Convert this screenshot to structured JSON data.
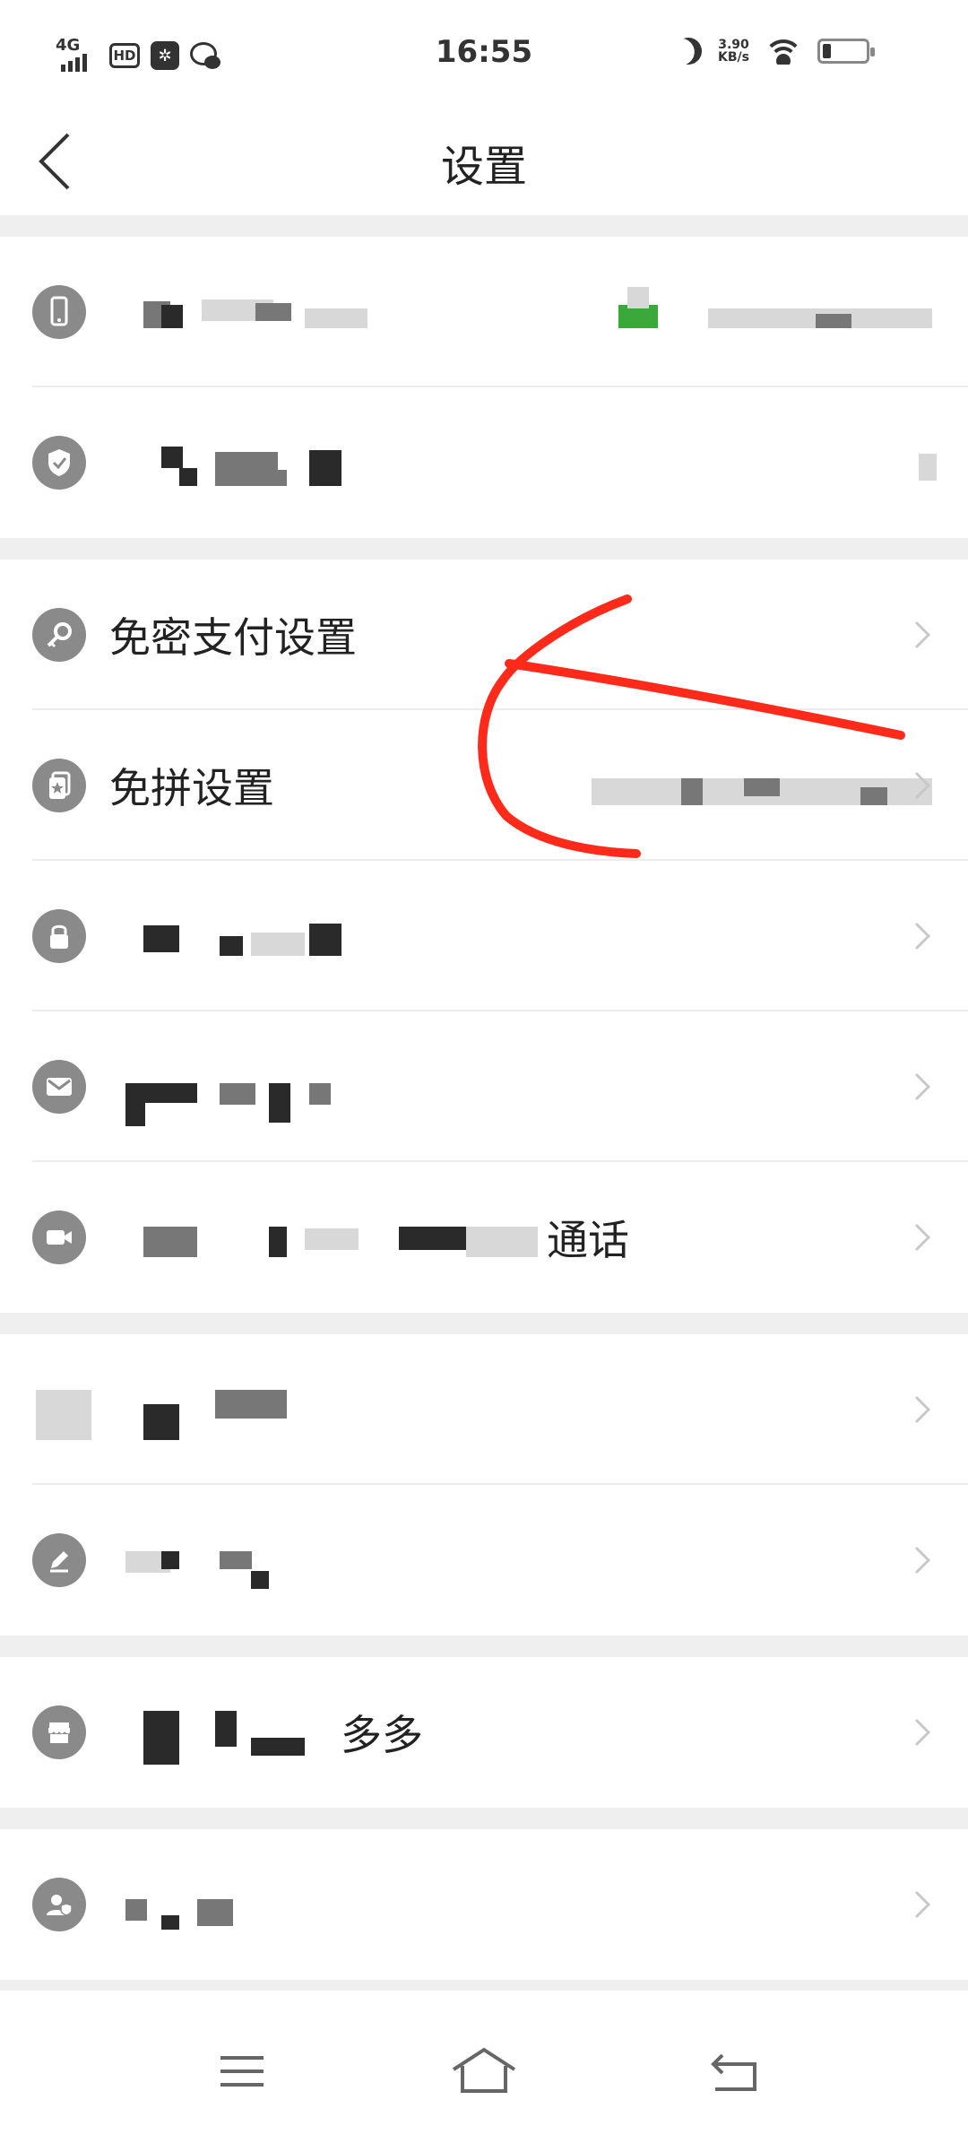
{
  "status_bar": {
    "network": "4G",
    "hd": "HD",
    "time": "16:55",
    "speed_value": "3.90",
    "speed_unit": "KB/s",
    "battery_level": 0.2
  },
  "header": {
    "title": "设置"
  },
  "settings": [
    {
      "id": "phone",
      "icon": "phone-icon",
      "label": "",
      "chevron": false
    },
    {
      "id": "account-security",
      "icon": "shield-check-icon",
      "label": "",
      "chevron": false
    },
    {
      "id": "password-free-payment",
      "icon": "key-icon",
      "label": "免密支付设置",
      "chevron": true
    },
    {
      "id": "free-group",
      "icon": "star-card-icon",
      "label": "免拼设置",
      "chevron": true
    },
    {
      "id": "lock",
      "icon": "lock-icon",
      "label": "",
      "chevron": true
    },
    {
      "id": "message",
      "icon": "mail-icon",
      "label": "",
      "chevron": true
    },
    {
      "id": "video-call",
      "icon": "video-camera-icon",
      "label": "",
      "chevron": true
    },
    {
      "id": "blank",
      "icon": "",
      "label": "",
      "chevron": true
    },
    {
      "id": "edit",
      "icon": "pencil-icon",
      "label": "",
      "chevron": true
    },
    {
      "id": "shop",
      "icon": "shop-icon",
      "label": "",
      "chevron": true
    },
    {
      "id": "privacy",
      "icon": "user-shield-icon",
      "label": "",
      "chevron": true
    }
  ],
  "partial_text": {
    "video_call_tail": "通话",
    "shop_tail": "多多"
  },
  "colors": {
    "annotation": "#ff2a1a",
    "icon_bg": "#8a8a8a",
    "separator": "#efefef"
  }
}
